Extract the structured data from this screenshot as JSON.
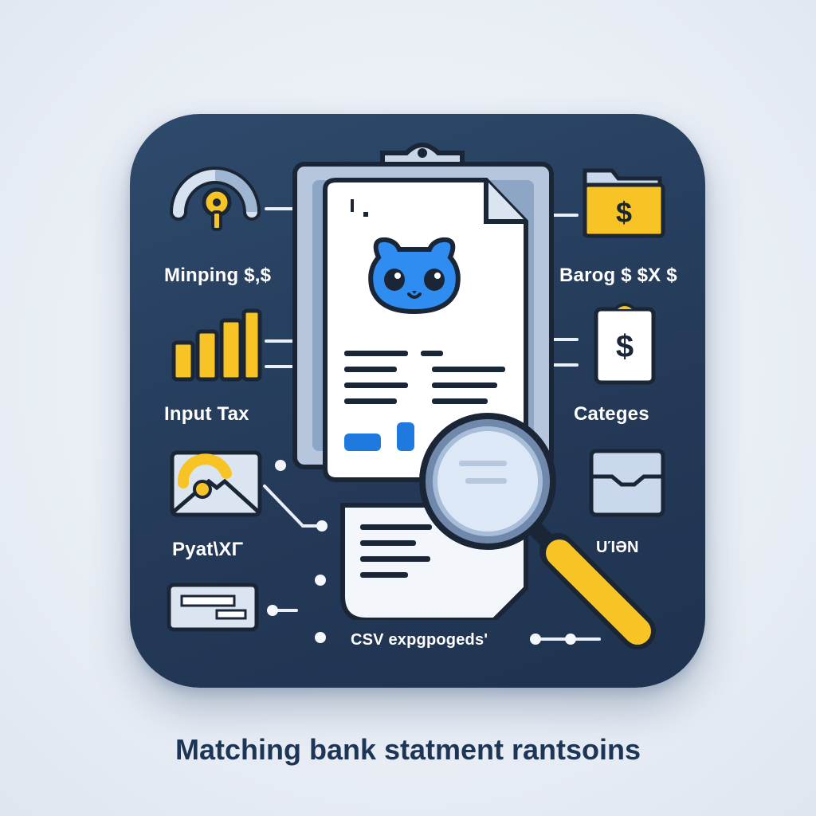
{
  "labels": {
    "left_1": "Minping $,$",
    "left_2": "Input Tax",
    "left_3": "Pyat\\XΓ",
    "right_1": "Barog $ $X $",
    "right_2": "Categes",
    "right_3": "UΊƏN",
    "bottom": "CSV expgpogeds'"
  },
  "caption": "Matching bank statment rantsoins",
  "icons": {
    "left_1": "gauge-with-key-icon",
    "left_2": "bar-chart-icon",
    "left_3": "envelope-icon",
    "left_4": "card-icon",
    "right_1": "folder-dollar-icon",
    "right_2": "receipt-dollar-icon",
    "right_3": "envelope-icon",
    "center": "clipboard-document-icon",
    "mascot": "cat-face-icon",
    "magnifier": "magnifying-glass-icon"
  },
  "colors": {
    "card_bg": "#2b4566",
    "accent_yellow": "#f7c325",
    "accent_blue": "#1f7ae0",
    "caption": "#1d3557"
  },
  "symbols": {
    "dollar": "$"
  }
}
